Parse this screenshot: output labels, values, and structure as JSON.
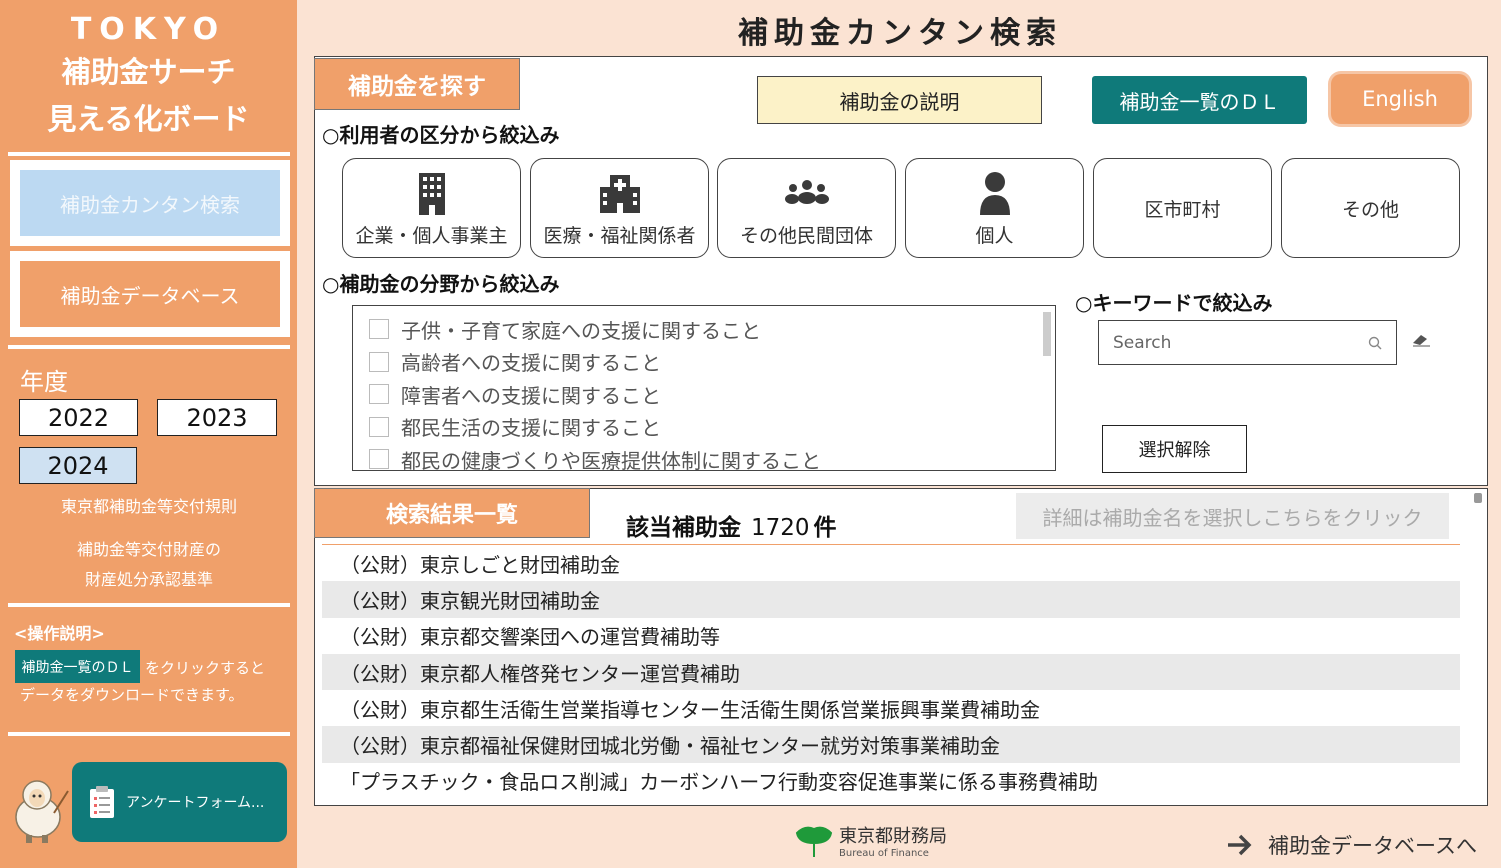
{
  "sidebar": {
    "brand": {
      "line1": "TOKYO",
      "line2": "補助金サーチ",
      "line3": "見える化ボード"
    },
    "nav": {
      "search": "補助金カンタン検索",
      "database": "補助金データベース"
    },
    "year_label": "年度",
    "years": [
      "2022",
      "2023",
      "2024"
    ],
    "selected_year": "2024",
    "links": {
      "rules": "東京都補助金等交付規則",
      "standard_line1": "補助金等交付財産の",
      "standard_line2": "財産処分承認基準"
    },
    "ops": {
      "title": "<操作説明>",
      "badge": "補助金一覧のＤＬ",
      "text1": "をクリックすると",
      "text2": "データをダウンロードできます。"
    },
    "survey_label": "アンケートフォーム..."
  },
  "header": {
    "title": "補助金カンタン検索"
  },
  "search_panel": {
    "tag": "補助金を探す",
    "explain_button": "補助金の説明",
    "download_button": "補助金一覧のＤＬ",
    "english_button": "English",
    "user_section": "○利用者の区分から絞込み",
    "categories": [
      {
        "label": "企業・個人事業主",
        "icon": "building-icon"
      },
      {
        "label": "医療・福祉関係者",
        "icon": "hospital-icon"
      },
      {
        "label": "その他民間団体",
        "icon": "group-icon"
      },
      {
        "label": "個人",
        "icon": "person-icon"
      },
      {
        "label": "区市町村",
        "icon": ""
      },
      {
        "label": "その他",
        "icon": ""
      }
    ],
    "field_section": "○補助金の分野から絞込み",
    "fields": [
      "子供・子育て家庭への支援に関すること",
      "高齢者への支援に関すること",
      "障害者への支援に関すること",
      "都民生活の支援に関すること",
      "都民の健康づくりや医療提供体制に関すること"
    ],
    "keyword_section": "○キーワードで絞込み",
    "search_placeholder": "Search",
    "clear_button": "選択解除"
  },
  "results": {
    "tag": "検索結果一覧",
    "count_label": "該当補助金",
    "count": "1720",
    "count_unit": "件",
    "detail_hint": "詳細は補助金名を選択しこちらをクリック",
    "items": [
      "（公財）東京しごと財団補助金",
      "（公財）東京観光財団補助金",
      "（公財）東京都交響楽団への運営費補助等",
      "（公財）東京都人権啓発センター運営費補助",
      "（公財）東京都生活衛生営業指導センター生活衛生関係営業振興事業費補助金",
      "（公財）東京都福祉保健財団城北労働・福祉センター就労対策事業補助金",
      "「プラスチック・食品ロス削減」カーボンハーフ行動変容促進事業に係る事務費補助"
    ]
  },
  "footer": {
    "logo_jp": "東京都財務局",
    "logo_en": "Bureau of Finance",
    "db_link": "補助金データベースへ"
  },
  "colors": {
    "accent": "#f0a06a",
    "teal": "#0f7a7a",
    "background": "#fbe3d3"
  }
}
